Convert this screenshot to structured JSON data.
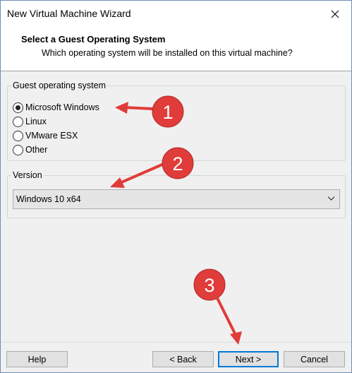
{
  "window": {
    "title": "New Virtual Machine Wizard",
    "close_icon": "close-icon"
  },
  "header": {
    "title": "Select a Guest Operating System",
    "subtitle": "Which operating system will be installed on this virtual machine?"
  },
  "guest_os": {
    "group_label": "Guest operating system",
    "options": [
      {
        "label": "Microsoft Windows",
        "selected": true
      },
      {
        "label": "Linux",
        "selected": false
      },
      {
        "label": "VMware ESX",
        "selected": false
      },
      {
        "label": "Other",
        "selected": false
      }
    ]
  },
  "version": {
    "group_label": "Version",
    "selected": "Windows 10 x64"
  },
  "buttons": {
    "help": "Help",
    "back": "< Back",
    "next": "Next >",
    "cancel": "Cancel"
  },
  "annotations": {
    "badge1": "1",
    "badge2": "2",
    "badge3": "3",
    "color": "#e03c3a"
  }
}
